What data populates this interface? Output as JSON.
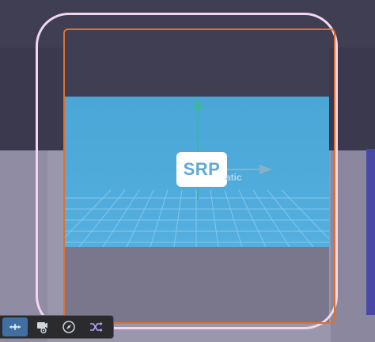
{
  "scene": {
    "badge_text": "SRP",
    "static_label_text": "atic"
  },
  "toolbar": {
    "tools": [
      {
        "icon": "move-tool-icon",
        "active": true
      },
      {
        "icon": "camera-view-icon",
        "active": false
      },
      {
        "icon": "compass-icon",
        "active": false
      },
      {
        "icon": "shuffle-icon",
        "active": false
      }
    ]
  },
  "colors": {
    "selection_outer": "#f2d8ef",
    "selection_inner": "#e0702e",
    "ground": "#4aa6d6",
    "gizmo_axis": "#3fb5a0",
    "toolbar_active": "#3f6fa3"
  }
}
